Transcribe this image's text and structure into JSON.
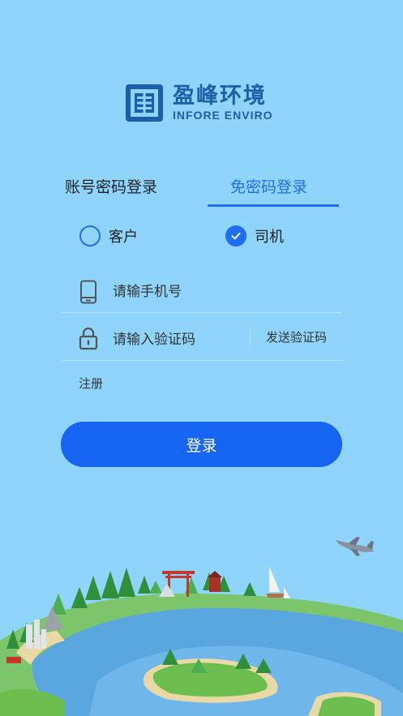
{
  "brand": {
    "name_cn": "盈峰环境",
    "name_en": "INFORE ENVIRO",
    "color": "#1b5fa8"
  },
  "tabs": [
    {
      "label": "账号密码登录",
      "active": false
    },
    {
      "label": "免密码登录",
      "active": true
    }
  ],
  "role": {
    "options": [
      {
        "label": "客户",
        "checked": false
      },
      {
        "label": "司机",
        "checked": true
      }
    ]
  },
  "phone": {
    "placeholder": "请输手机号",
    "value": "",
    "icon": "phone-icon"
  },
  "code": {
    "placeholder": "请输入验证码",
    "value": "",
    "icon": "lock-icon",
    "send_label": "发送验证码"
  },
  "register_label": "注册",
  "login_label": "登录",
  "colors": {
    "accent": "#1f6ef0",
    "button": "#1565f2",
    "background": "#8fd5fb"
  }
}
